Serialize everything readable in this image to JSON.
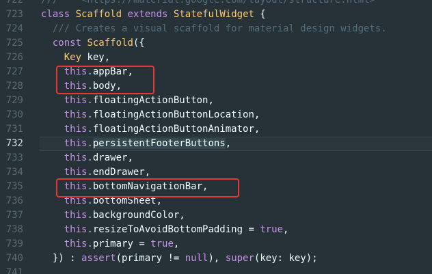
{
  "editor": {
    "lines": [
      {
        "num": "722",
        "tokens": [
          {
            "t": "///  * <https://material.google.com/layout/structure.html>",
            "c": "cmt"
          }
        ]
      },
      {
        "num": "723",
        "tokens": [
          {
            "t": "class",
            "c": "kw"
          },
          {
            "t": " ",
            "c": "plain"
          },
          {
            "t": "Scaffold",
            "c": "cls"
          },
          {
            "t": " ",
            "c": "plain"
          },
          {
            "t": "extends",
            "c": "kw"
          },
          {
            "t": " ",
            "c": "plain"
          },
          {
            "t": "StatefulWidget",
            "c": "cls"
          },
          {
            "t": " {",
            "c": "plain"
          }
        ]
      },
      {
        "num": "724",
        "tokens": [
          {
            "t": "  /// Creates a visual scaffold for material design widgets.",
            "c": "cmt"
          }
        ]
      },
      {
        "num": "725",
        "tokens": [
          {
            "t": "  ",
            "c": "plain"
          },
          {
            "t": "const",
            "c": "kw"
          },
          {
            "t": " ",
            "c": "plain"
          },
          {
            "t": "Scaffold",
            "c": "cls"
          },
          {
            "t": "({",
            "c": "plain"
          }
        ]
      },
      {
        "num": "726",
        "tokens": [
          {
            "t": "    ",
            "c": "plain"
          },
          {
            "t": "Key",
            "c": "cls"
          },
          {
            "t": " key,",
            "c": "plain"
          }
        ]
      },
      {
        "num": "727",
        "tokens": [
          {
            "t": "    ",
            "c": "plain"
          },
          {
            "t": "this",
            "c": "this"
          },
          {
            "t": ".",
            "c": "punct"
          },
          {
            "t": "appBar",
            "c": "prop"
          },
          {
            "t": ",",
            "c": "plain"
          }
        ]
      },
      {
        "num": "728",
        "tokens": [
          {
            "t": "    ",
            "c": "plain"
          },
          {
            "t": "this",
            "c": "this"
          },
          {
            "t": ".",
            "c": "punct"
          },
          {
            "t": "body",
            "c": "prop"
          },
          {
            "t": ",",
            "c": "plain"
          }
        ]
      },
      {
        "num": "729",
        "tokens": [
          {
            "t": "    ",
            "c": "plain"
          },
          {
            "t": "this",
            "c": "this"
          },
          {
            "t": ".",
            "c": "punct"
          },
          {
            "t": "floatingActionButton",
            "c": "prop"
          },
          {
            "t": ",",
            "c": "plain"
          }
        ]
      },
      {
        "num": "730",
        "tokens": [
          {
            "t": "    ",
            "c": "plain"
          },
          {
            "t": "this",
            "c": "this"
          },
          {
            "t": ".",
            "c": "punct"
          },
          {
            "t": "floatingActionButtonLocation",
            "c": "prop"
          },
          {
            "t": ",",
            "c": "plain"
          }
        ]
      },
      {
        "num": "731",
        "tokens": [
          {
            "t": "    ",
            "c": "plain"
          },
          {
            "t": "this",
            "c": "this"
          },
          {
            "t": ".",
            "c": "punct"
          },
          {
            "t": "floatingActionButtonAnimator",
            "c": "prop"
          },
          {
            "t": ",",
            "c": "plain"
          }
        ]
      },
      {
        "num": "732",
        "current": true,
        "tokens": [
          {
            "t": "    ",
            "c": "plain"
          },
          {
            "t": "this",
            "c": "this"
          },
          {
            "t": ".",
            "c": "punct"
          },
          {
            "t": "persistentFooterButtons",
            "c": "prop hl"
          },
          {
            "t": ",",
            "c": "plain"
          }
        ]
      },
      {
        "num": "733",
        "tokens": [
          {
            "t": "    ",
            "c": "plain"
          },
          {
            "t": "this",
            "c": "this"
          },
          {
            "t": ".",
            "c": "punct"
          },
          {
            "t": "drawer",
            "c": "prop"
          },
          {
            "t": ",",
            "c": "plain"
          }
        ]
      },
      {
        "num": "734",
        "tokens": [
          {
            "t": "    ",
            "c": "plain"
          },
          {
            "t": "this",
            "c": "this"
          },
          {
            "t": ".",
            "c": "punct"
          },
          {
            "t": "endDrawer",
            "c": "prop"
          },
          {
            "t": ",",
            "c": "plain"
          }
        ]
      },
      {
        "num": "735",
        "tokens": [
          {
            "t": "    ",
            "c": "plain"
          },
          {
            "t": "this",
            "c": "this"
          },
          {
            "t": ".",
            "c": "punct"
          },
          {
            "t": "bottomNavigationBar",
            "c": "prop"
          },
          {
            "t": ",",
            "c": "plain"
          }
        ]
      },
      {
        "num": "736",
        "tokens": [
          {
            "t": "    ",
            "c": "plain"
          },
          {
            "t": "this",
            "c": "this"
          },
          {
            "t": ".",
            "c": "punct"
          },
          {
            "t": "bottomSheet",
            "c": "prop"
          },
          {
            "t": ",",
            "c": "plain"
          }
        ]
      },
      {
        "num": "737",
        "tokens": [
          {
            "t": "    ",
            "c": "plain"
          },
          {
            "t": "this",
            "c": "this"
          },
          {
            "t": ".",
            "c": "punct"
          },
          {
            "t": "backgroundColor",
            "c": "prop"
          },
          {
            "t": ",",
            "c": "plain"
          }
        ]
      },
      {
        "num": "738",
        "tokens": [
          {
            "t": "    ",
            "c": "plain"
          },
          {
            "t": "this",
            "c": "this"
          },
          {
            "t": ".",
            "c": "punct"
          },
          {
            "t": "resizeToAvoidBottomPadding",
            "c": "prop"
          },
          {
            "t": " = ",
            "c": "plain"
          },
          {
            "t": "true",
            "c": "lit"
          },
          {
            "t": ",",
            "c": "plain"
          }
        ]
      },
      {
        "num": "739",
        "tokens": [
          {
            "t": "    ",
            "c": "plain"
          },
          {
            "t": "this",
            "c": "this"
          },
          {
            "t": ".",
            "c": "punct"
          },
          {
            "t": "primary",
            "c": "prop"
          },
          {
            "t": " = ",
            "c": "plain"
          },
          {
            "t": "true",
            "c": "lit"
          },
          {
            "t": ",",
            "c": "plain"
          }
        ]
      },
      {
        "num": "740",
        "tokens": [
          {
            "t": "  }) : ",
            "c": "plain"
          },
          {
            "t": "assert",
            "c": "kw"
          },
          {
            "t": "(primary != ",
            "c": "plain"
          },
          {
            "t": "null",
            "c": "lit"
          },
          {
            "t": "), ",
            "c": "plain"
          },
          {
            "t": "super",
            "c": "kw"
          },
          {
            "t": "(key: key);",
            "c": "plain"
          }
        ]
      },
      {
        "num": "741",
        "tokens": []
      }
    ]
  },
  "colors": {
    "background": "#263238",
    "annotation_box": "#e53935"
  }
}
